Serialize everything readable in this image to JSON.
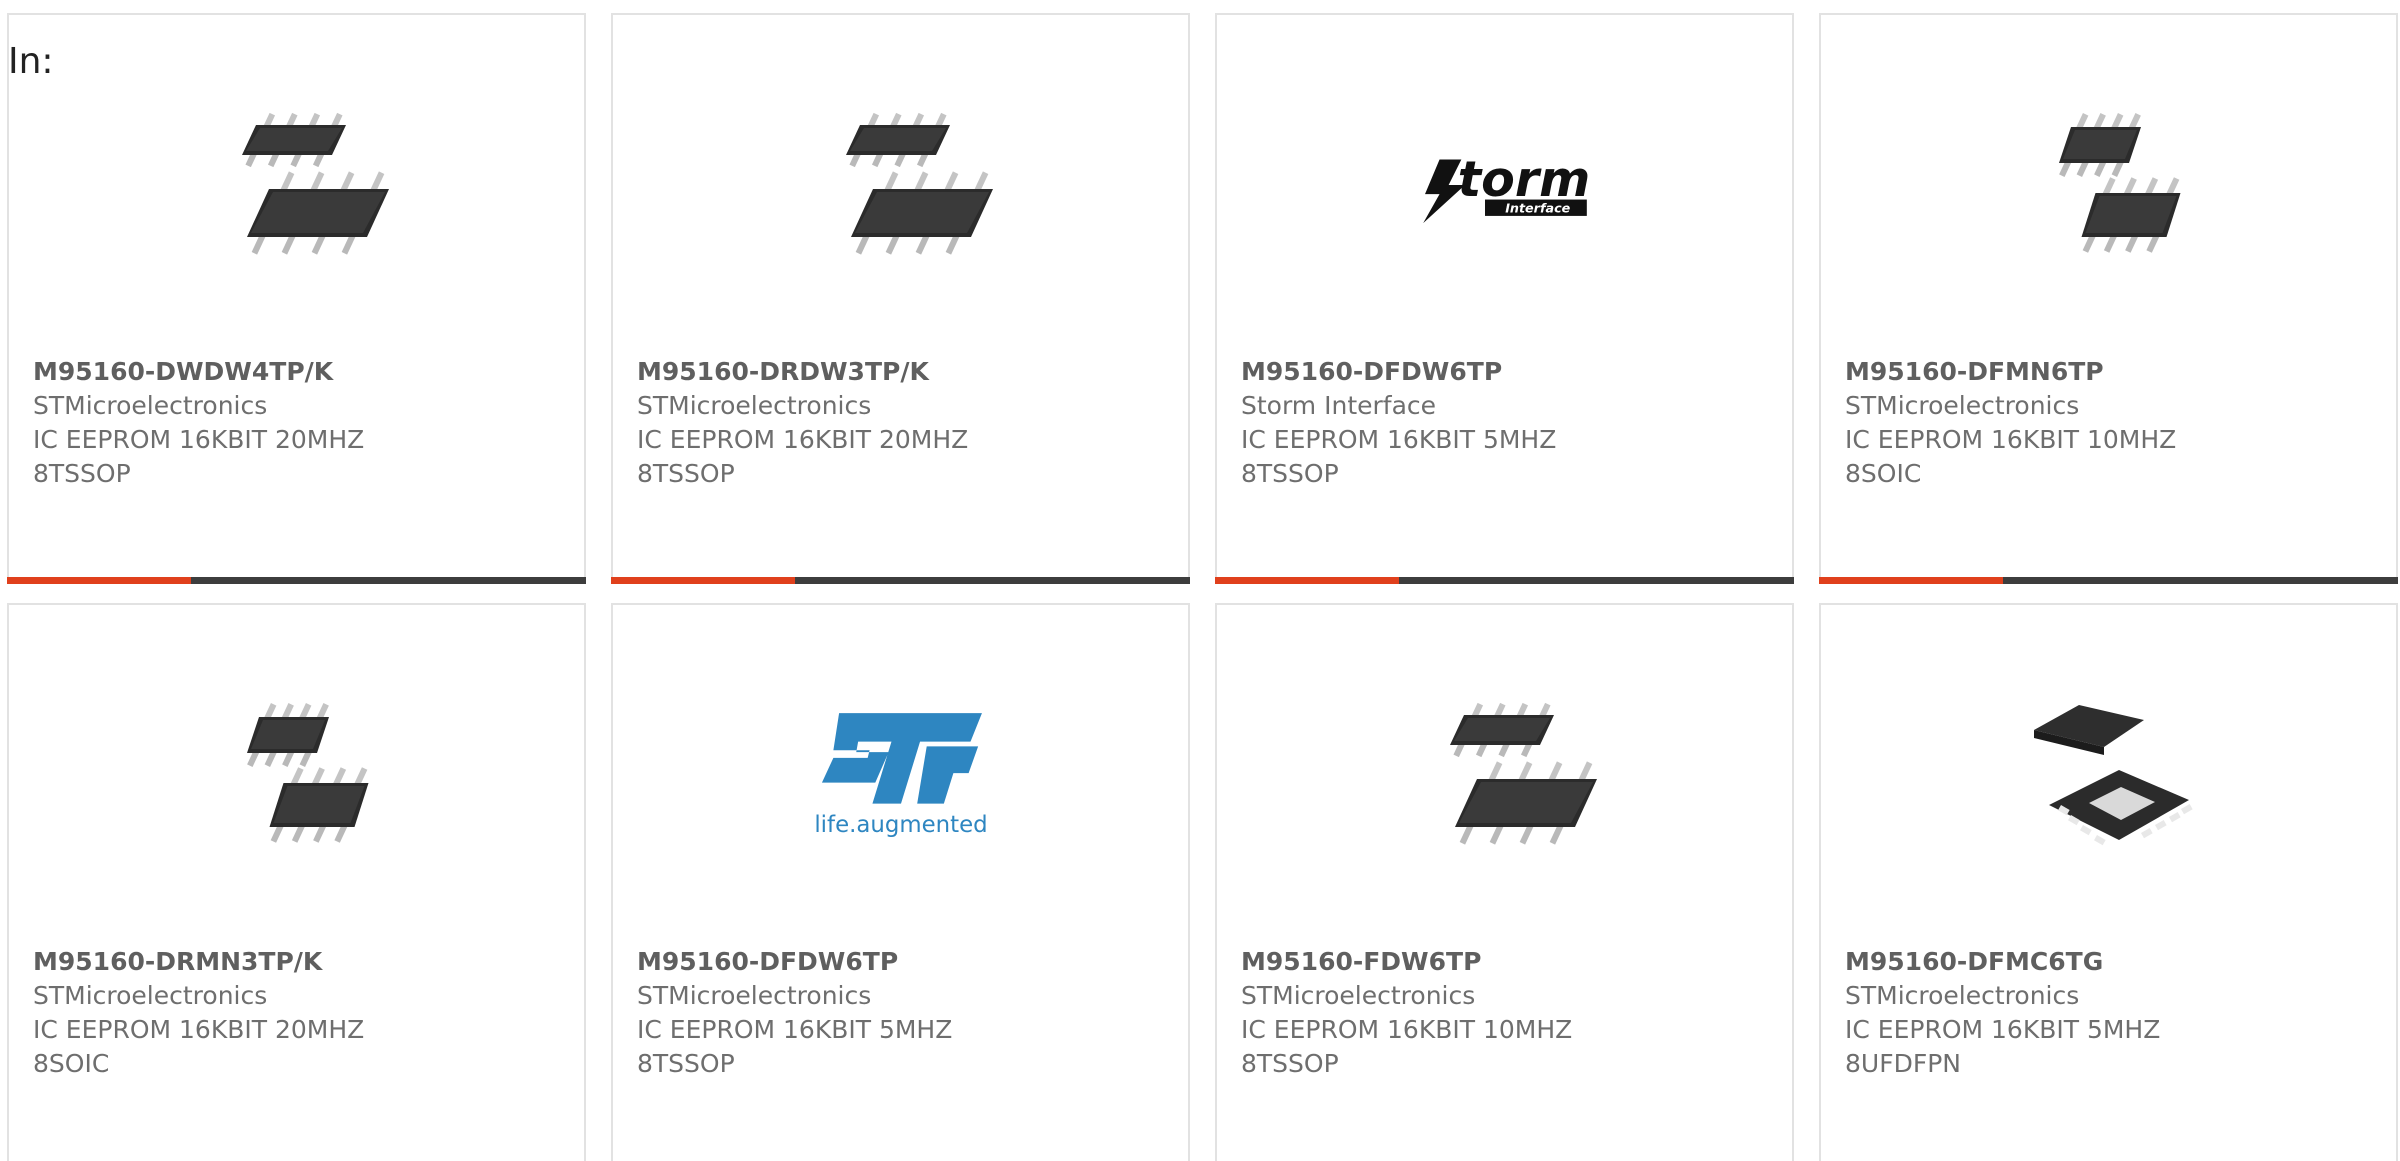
{
  "header": {
    "in_label": "In:"
  },
  "colors": {
    "accent": "#e0401c",
    "bar": "#3d3d3d",
    "text": "#6e6e6e",
    "part": "#5f5f5f",
    "st_blue": "#2e86c1"
  },
  "cards": [
    {
      "part": "M95160-DWDW4TP/K",
      "manufacturer": "STMicroelectronics",
      "description": "IC EEPROM 16KBIT 20MHZ",
      "package": "8TSSOP",
      "image": "tssop-chip-image"
    },
    {
      "part": "M95160-DRDW3TP/K",
      "manufacturer": "STMicroelectronics",
      "description": "IC EEPROM 16KBIT 20MHZ",
      "package": "8TSSOP",
      "image": "tssop-chip-image"
    },
    {
      "part": "M95160-DFDW6TP",
      "manufacturer": "Storm Interface",
      "description": "IC EEPROM 16KBIT 5MHZ",
      "package": "8TSSOP",
      "image": "storm-interface-logo",
      "logo_text": "torm",
      "logo_subtext": "Interface"
    },
    {
      "part": "M95160-DFMN6TP",
      "manufacturer": "STMicroelectronics",
      "description": "IC EEPROM 16KBIT 10MHZ",
      "package": "8SOIC",
      "image": "soic-chip-image"
    },
    {
      "part": "M95160-DRMN3TP/K",
      "manufacturer": "STMicroelectronics",
      "description": "IC EEPROM 16KBIT 20MHZ",
      "package": "8SOIC",
      "image": "soic-chip-image"
    },
    {
      "part": "M95160-DFDW6TP",
      "manufacturer": "STMicroelectronics",
      "description": "IC EEPROM 16KBIT 5MHZ",
      "package": "8TSSOP",
      "image": "st-life-augmented-logo",
      "logo_text": "life.augmented"
    },
    {
      "part": "M95160-FDW6TP",
      "manufacturer": "STMicroelectronics",
      "description": "IC EEPROM 16KBIT 10MHZ",
      "package": "8TSSOP",
      "image": "tssop-chip-image"
    },
    {
      "part": "M95160-DFMC6TG",
      "manufacturer": "STMicroelectronics",
      "description": "IC EEPROM 16KBIT 5MHZ",
      "package": "8UFDFPN",
      "image": "ufdfpn-chip-image"
    }
  ]
}
